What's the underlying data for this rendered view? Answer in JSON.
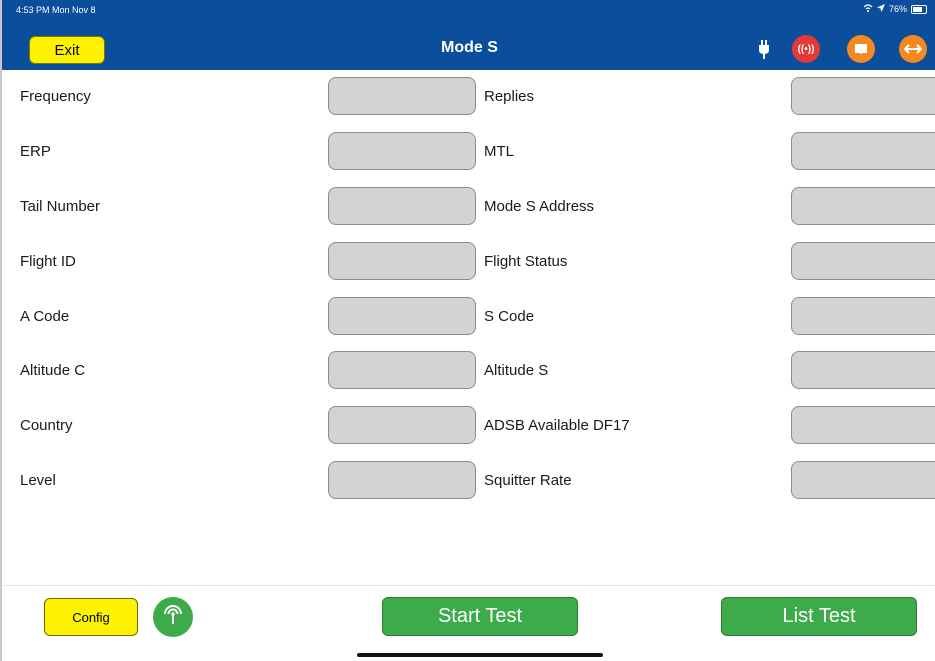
{
  "status_bar": {
    "time": "4:53 PM  Mon Nov 8",
    "battery": "76%"
  },
  "header": {
    "title": "Mode S",
    "exit_label": "Exit",
    "color": "#0b4f9c",
    "icons": [
      "plug-icon",
      "broadcast-icon",
      "book-icon",
      "swap-arrows-icon"
    ],
    "broadcast_glyph": "((•))"
  },
  "fields_left": [
    {
      "label": "Frequency",
      "value": ""
    },
    {
      "label": "ERP",
      "value": ""
    },
    {
      "label": "Tail Number",
      "value": ""
    },
    {
      "label": "Flight ID",
      "value": ""
    },
    {
      "label": "A Code",
      "value": ""
    },
    {
      "label": "Altitude C",
      "value": ""
    },
    {
      "label": "Country",
      "value": ""
    },
    {
      "label": "Level",
      "value": ""
    }
  ],
  "fields_right": [
    {
      "label": "Replies",
      "value": ""
    },
    {
      "label": "MTL",
      "value": ""
    },
    {
      "label": "Mode S Address",
      "value": ""
    },
    {
      "label": "Flight Status",
      "value": ""
    },
    {
      "label": "S Code",
      "value": ""
    },
    {
      "label": "Altitude S",
      "value": ""
    },
    {
      "label": "ADSB Available DF17",
      "value": ""
    },
    {
      "label": "Squitter Rate",
      "value": ""
    }
  ],
  "footer": {
    "config_label": "Config",
    "start_label": "Start Test",
    "list_label": "List Test",
    "green": "#3dab4a",
    "yellow": "#fff200"
  }
}
